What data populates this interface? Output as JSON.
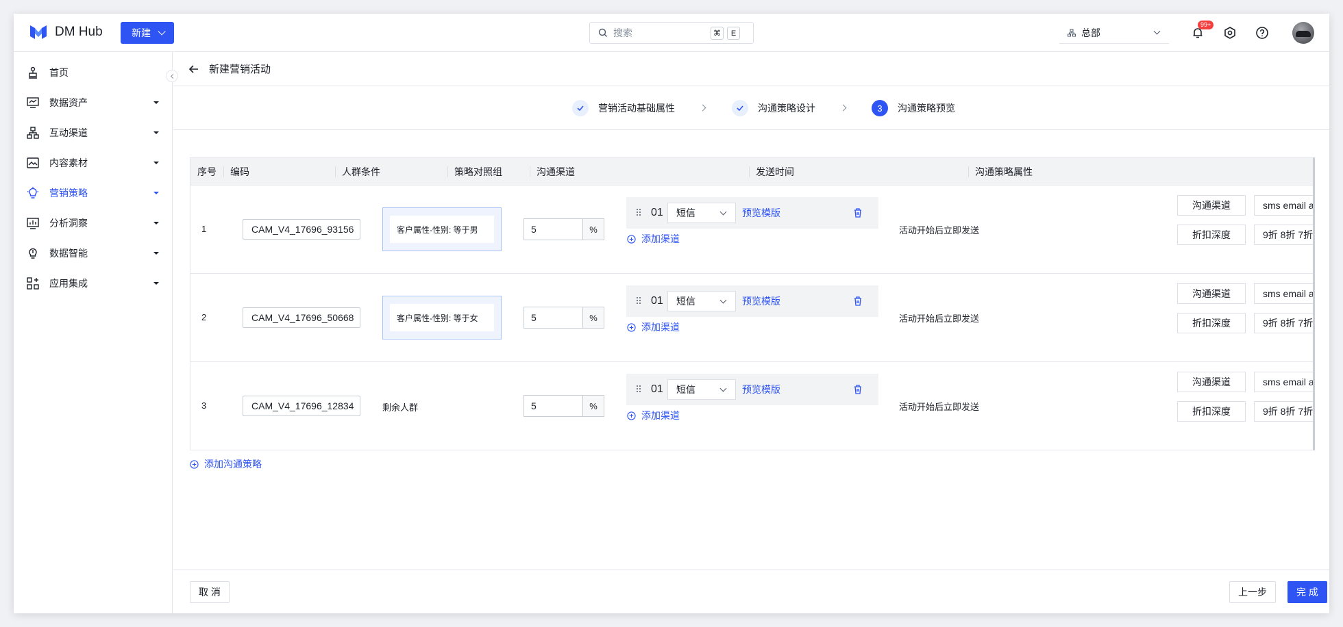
{
  "app": {
    "title": "DM Hub",
    "new_button": "新建"
  },
  "search": {
    "placeholder": "搜索",
    "kbd_1": "⌘",
    "kbd_2": "E"
  },
  "org": {
    "label": "总部"
  },
  "notifications": {
    "badge": "99+"
  },
  "sidebar": {
    "items": [
      {
        "label": "首页",
        "icon": "home-icon",
        "has_caret": false,
        "active": false
      },
      {
        "label": "数据资产",
        "icon": "data-assets-icon",
        "has_caret": true,
        "active": false
      },
      {
        "label": "互动渠道",
        "icon": "channels-icon",
        "has_caret": true,
        "active": false
      },
      {
        "label": "内容素材",
        "icon": "content-icon",
        "has_caret": true,
        "active": false
      },
      {
        "label": "营销策略",
        "icon": "strategy-icon",
        "has_caret": true,
        "active": true
      },
      {
        "label": "分析洞察",
        "icon": "analytics-icon",
        "has_caret": true,
        "active": false
      },
      {
        "label": "数据智能",
        "icon": "intelligence-icon",
        "has_caret": true,
        "active": false
      },
      {
        "label": "应用集成",
        "icon": "apps-icon",
        "has_caret": true,
        "active": false
      }
    ]
  },
  "page": {
    "title": "新建营销活动"
  },
  "steps": [
    {
      "label": "营销活动基础属性",
      "status": "done"
    },
    {
      "label": "沟通策略设计",
      "status": "done"
    },
    {
      "label": "沟通策略预览",
      "status": "current",
      "number": "3"
    }
  ],
  "table": {
    "headers": [
      "序号",
      "编码",
      "人群条件",
      "策略对照组",
      "沟通渠道",
      "发送时间",
      "沟通策略属性"
    ],
    "rows": [
      {
        "index": "1",
        "code": "CAM_V4_17696_93156",
        "condition": "客户属性-性别: 等于男",
        "condition_boxed": true,
        "control_pct": "5",
        "pct_unit": "%",
        "channel_num": "01",
        "channel": "短信",
        "preview": "预览模版",
        "add_channel": "添加渠道",
        "send_time": "活动开始后立即发送",
        "attr_1_label": "沟通渠道",
        "attr_1_value": "sms email a",
        "attr_2_label": "折扣深度",
        "attr_2_value": "9折 8折 7折"
      },
      {
        "index": "2",
        "code": "CAM_V4_17696_50668",
        "condition": "客户属性-性别: 等于女",
        "condition_boxed": true,
        "control_pct": "5",
        "pct_unit": "%",
        "channel_num": "01",
        "channel": "短信",
        "preview": "预览模版",
        "add_channel": "添加渠道",
        "send_time": "活动开始后立即发送",
        "attr_1_label": "沟通渠道",
        "attr_1_value": "sms email a",
        "attr_2_label": "折扣深度",
        "attr_2_value": "9折 8折 7折"
      },
      {
        "index": "3",
        "code": "CAM_V4_17696_12834",
        "condition": "剩余人群",
        "condition_boxed": false,
        "control_pct": "5",
        "pct_unit": "%",
        "channel_num": "01",
        "channel": "短信",
        "preview": "预览模版",
        "add_channel": "添加渠道",
        "send_time": "活动开始后立即发送",
        "attr_1_label": "沟通渠道",
        "attr_1_value": "sms email a",
        "attr_2_label": "折扣深度",
        "attr_2_value": "9折 8折 7折"
      }
    ]
  },
  "add_strategy": "添加沟通策略",
  "footer": {
    "cancel": "取 消",
    "prev": "上一步",
    "finish": "完 成"
  },
  "colors": {
    "primary": "#2e54f3",
    "badge": "#f53f3f",
    "header_bg": "#f2f3f5"
  }
}
